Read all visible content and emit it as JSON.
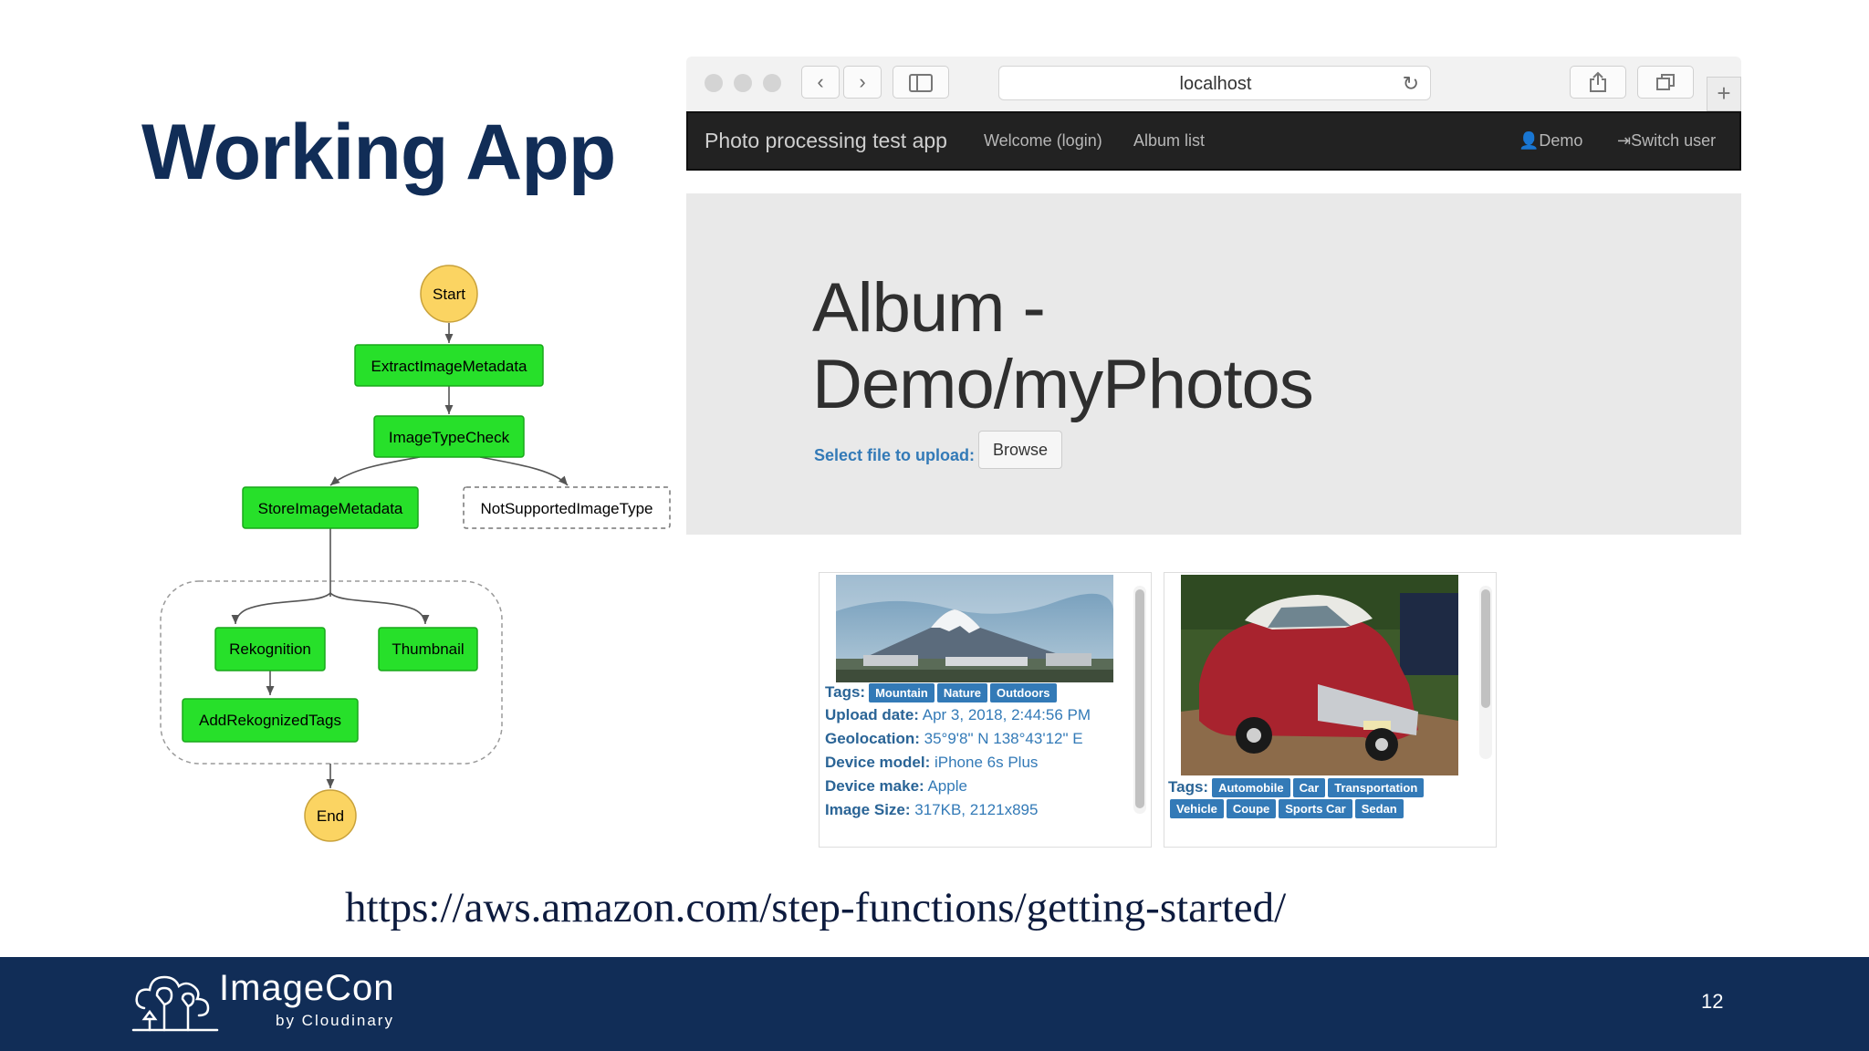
{
  "slide": {
    "title": "Working App",
    "url": "https://aws.amazon.com/step-functions/getting-started/",
    "page_number": "12"
  },
  "logo": {
    "name": "ImageCon",
    "sub": "by Cloudinary",
    "icon": "cloud-trees-icon"
  },
  "flowchart": {
    "start": "Start",
    "end": "End",
    "nodes": {
      "extract": "ExtractImageMetadata",
      "typecheck": "ImageTypeCheck",
      "store": "StoreImageMetadata",
      "notsupported": "NotSupportedImageType",
      "rekognition": "Rekognition",
      "thumbnail": "Thumbnail",
      "addtags": "AddRekognizedTags"
    },
    "colors": {
      "task": "#27e02a",
      "terminal": "#fbd462",
      "edge": "#555555"
    }
  },
  "browser": {
    "address": "localhost",
    "icons": [
      "back-icon",
      "forward-icon",
      "sidebar-icon",
      "reload-icon",
      "share-icon",
      "tabs-icon",
      "new-tab-icon"
    ],
    "nav": {
      "brand": "Photo processing test app",
      "welcome": "Welcome (login)",
      "album_list": "Album list",
      "user": "Demo",
      "switch_user": "Switch user"
    },
    "album": {
      "title_line1": "Album -",
      "title_line2": "Demo/myPhotos",
      "upload_label": "Select file to upload:",
      "browse": "Browse"
    },
    "photos": [
      {
        "tags_label": "Tags:",
        "tags": [
          "Mountain",
          "Nature",
          "Outdoors"
        ],
        "fields": [
          {
            "label": "Upload date:",
            "value": " Apr 3, 2018, 2:44:56 PM"
          },
          {
            "label": "Geolocation:",
            "value": " 35°9'8\" N 138°43'12\" E"
          },
          {
            "label": "Device model:",
            "value": " iPhone 6s Plus"
          },
          {
            "label": "Device make:",
            "value": " Apple"
          },
          {
            "label": "Image Size:",
            "value": " 317KB, 2121x895"
          }
        ]
      },
      {
        "tags_label": "Tags:",
        "tags_row1": [
          "Automobile",
          "Car",
          "Transportation"
        ],
        "tags_row2": [
          "Vehicle",
          "Coupe",
          "Sports Car",
          "Sedan"
        ]
      }
    ]
  }
}
